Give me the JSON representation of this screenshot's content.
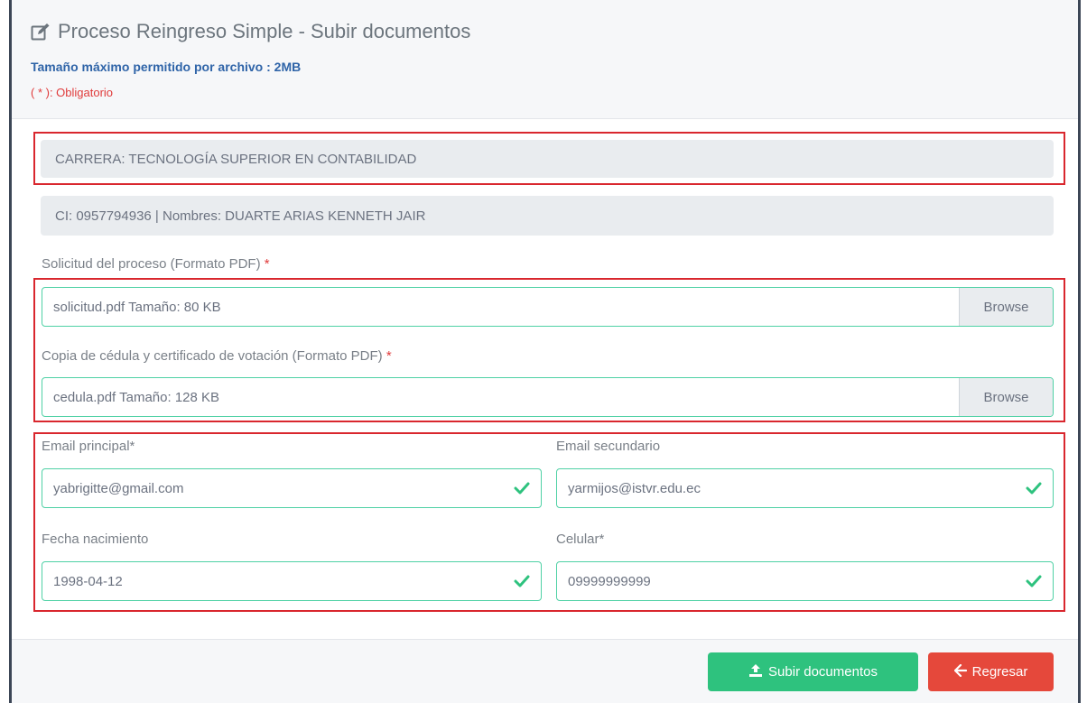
{
  "header": {
    "title": "Proceso Reingreso Simple - Subir documentos",
    "max_size_note": "Tamaño máximo permitido por archivo : 2MB",
    "required_note": "( * ): Obligatorio"
  },
  "carrera": "CARRERA: TECNOLOGÍA SUPERIOR EN CONTABILIDAD",
  "student": "CI: 0957794936 | Nombres: DUARTE ARIAS KENNETH JAIR",
  "files": [
    {
      "label": "Solicitud del proceso (Formato PDF)",
      "required_mark": "*",
      "value": "solicitud.pdf Tamaño: 80 KB",
      "button": "Browse"
    },
    {
      "label": "Copia de cédula y certificado de votación (Formato PDF)",
      "required_mark": "*",
      "value": "cedula.pdf Tamaño: 128 KB",
      "button": "Browse"
    }
  ],
  "fields": {
    "email_principal": {
      "label": "Email principal*",
      "value": "yabrigitte@gmail.com"
    },
    "email_secundario": {
      "label": "Email secundario",
      "value": "yarmijos@istvr.edu.ec"
    },
    "fecha_nacimiento": {
      "label": "Fecha nacimiento",
      "value": "1998-04-12"
    },
    "celular": {
      "label": "Celular*",
      "value": "09999999999"
    }
  },
  "buttons": {
    "upload": "Subir documentos",
    "back": "Regresar"
  },
  "icons": {
    "title": "edit-icon",
    "upload": "upload-icon",
    "back": "arrow-left-icon",
    "valid": "check-icon"
  },
  "colors": {
    "success": "#2ec27e",
    "danger": "#e5483b",
    "valid_border": "#4fd1a5",
    "highlight": "#d9272e",
    "info": "#2f64a8"
  }
}
